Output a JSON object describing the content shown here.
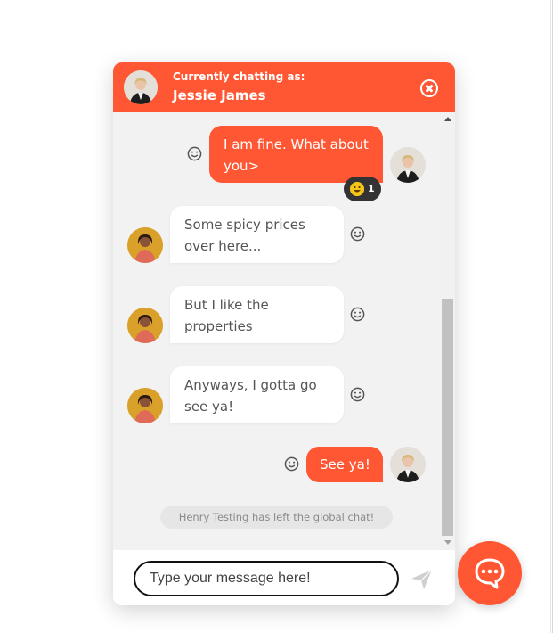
{
  "header": {
    "caption": "Currently chatting as:",
    "user_name": "Jessie James",
    "close_icon": "close-icon"
  },
  "messages": [
    {
      "from": "me",
      "lines": [
        "I am fine. What about",
        "you>"
      ],
      "reaction": {
        "emoji": "grinning-face",
        "count": "1"
      }
    },
    {
      "from": "them",
      "lines": [
        "Some spicy prices",
        "over here..."
      ]
    },
    {
      "from": "them",
      "lines": [
        "But I like the",
        "properties"
      ]
    },
    {
      "from": "them",
      "lines": [
        "Anyways, I gotta go",
        "see ya!"
      ]
    },
    {
      "from": "me",
      "lines": [
        "See ya!"
      ]
    }
  ],
  "system_note": "Henry Testing has left the global chat!",
  "composer": {
    "placeholder": "Type your message here!",
    "value": ""
  },
  "colors": {
    "accent": "#ff5733",
    "background": "#f2f2f2",
    "bubble_in": "#ffffff",
    "reaction_badge": "#333333"
  }
}
